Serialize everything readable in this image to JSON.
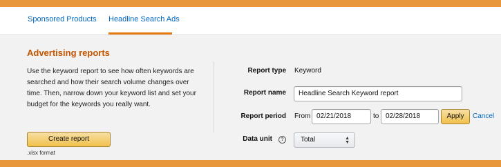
{
  "tabs": [
    {
      "label": "Sponsored Products"
    },
    {
      "label": "Headline Search Ads"
    }
  ],
  "panel": {
    "title": "Advertising reports",
    "description": "Use the keyword report to see how often keywords are searched and how their search volume changes over time. Then, narrow down your keyword list and set your budget for the keywords you really want.",
    "create_button": "Create report",
    "format_note": ".xlsx format"
  },
  "form": {
    "report_type_label": "Report type",
    "report_type_value": "Keyword",
    "report_name_label": "Report name",
    "report_name_value": "Headline Search Keyword report",
    "report_period_label": "Report period",
    "from_label": "From",
    "from_date": "02/21/2018",
    "to_label": "to",
    "to_date": "02/28/2018",
    "apply_button": "Apply",
    "cancel_link": "Cancel",
    "data_unit_label": "Data unit",
    "data_unit_value": "Total"
  },
  "colors": {
    "accent_orange": "#e8983a",
    "title_orange": "#c45500",
    "link_blue": "#0066c0",
    "button_yellow": "#f0c14b"
  },
  "icons": {
    "help": "question-circle-icon",
    "select_arrows": "chevron-up-down-icon"
  }
}
